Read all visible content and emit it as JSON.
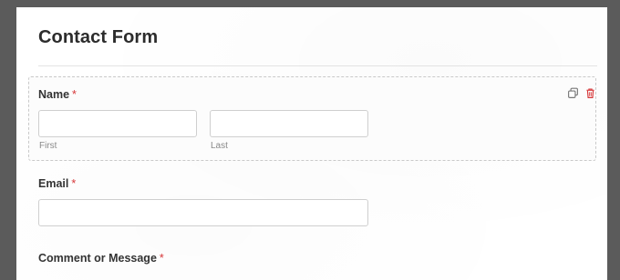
{
  "form": {
    "title": "Contact Form",
    "fields": {
      "name": {
        "label": "Name",
        "required_mark": "*",
        "first_sublabel": "First",
        "last_sublabel": "Last",
        "first_value": "",
        "last_value": ""
      },
      "email": {
        "label": "Email",
        "required_mark": "*",
        "value": ""
      },
      "comment": {
        "label": "Comment or Message",
        "required_mark": "*"
      }
    },
    "actions": {
      "duplicate_icon": "duplicate-icon",
      "delete_icon": "trash-icon"
    }
  },
  "colors": {
    "backdrop": "#5b5b5b",
    "panel": "#ffffff",
    "required": "#d63638",
    "delete_icon": "#d63638",
    "duplicate_icon": "#777777",
    "field_border_dashed": "#c9c9c9"
  }
}
